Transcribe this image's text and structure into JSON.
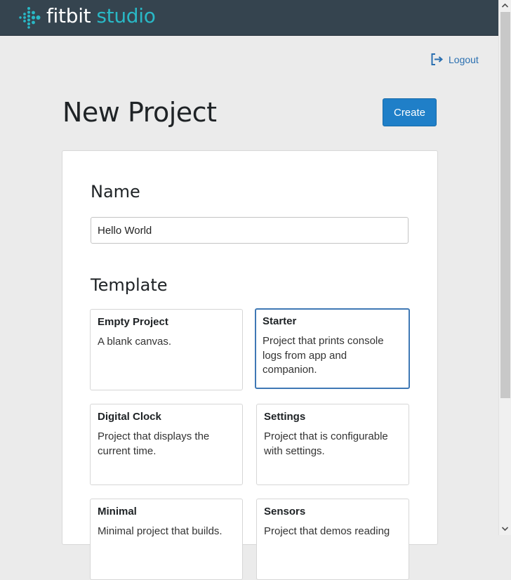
{
  "header": {
    "brand_primary": "fitbit",
    "brand_secondary": "studio",
    "logo_icon": "fitbit-dots-logo",
    "colors": {
      "bar": "#35444f",
      "accent": "#29b8c6"
    }
  },
  "account": {
    "logout_label": "Logout",
    "logout_icon": "logout-icon"
  },
  "page": {
    "title": "New Project",
    "create_label": "Create",
    "create_color": "#1f7fc8"
  },
  "form": {
    "name_label": "Name",
    "name_value": "Hello World",
    "template_label": "Template",
    "selected_template": "Starter",
    "templates": [
      {
        "title": "Empty Project",
        "description": "A blank canvas."
      },
      {
        "title": "Starter",
        "description": "Project that prints console logs from app and companion."
      },
      {
        "title": "Digital Clock",
        "description": "Project that displays the current time."
      },
      {
        "title": "Settings",
        "description": "Project that is configurable with settings."
      },
      {
        "title": "Minimal",
        "description": "Minimal project that builds."
      },
      {
        "title": "Sensors",
        "description": "Project that demos reading"
      }
    ]
  },
  "scrollbar": {
    "up_icon": "▲",
    "down_icon": "▼"
  }
}
